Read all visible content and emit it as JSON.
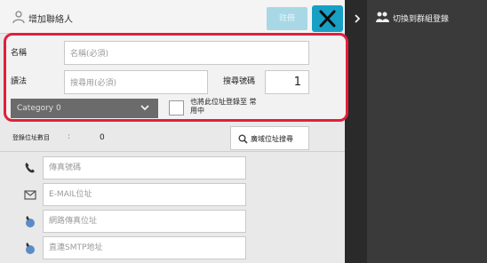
{
  "dialog": {
    "title": "增加聯絡人",
    "register_label": "註冊",
    "close_icon": "close-icon"
  },
  "form": {
    "name_label": "名稱",
    "name_placeholder": "名稱(必須)",
    "reading_label": "讀法",
    "reading_placeholder": "搜尋用(必須)",
    "search_number_label": "搜尋號碼",
    "search_number_value": "1",
    "category_value": "Category 0",
    "default_checkbox_text": "也將此位址登錄至 常用中",
    "default_checkbox_checked": false
  },
  "address": {
    "count_label": "登錄位址數目",
    "count_separator": ":",
    "count_value": "0",
    "global_search_label": "廣域位址搜尋",
    "rows": [
      {
        "icon": "fax-icon",
        "placeholder": "傳真號碼"
      },
      {
        "icon": "email-icon",
        "placeholder": "E-MAIL位址"
      },
      {
        "icon": "internet-fax-icon",
        "placeholder": "網路傳真位址"
      },
      {
        "icon": "smtp-icon",
        "placeholder": "直連SMTP地址"
      }
    ]
  },
  "side_panel": {
    "group_label": "切換到群組登錄",
    "group_icon": "group-icon"
  },
  "colors": {
    "accent": "#17a0c4",
    "highlight_border": "#e0203a"
  }
}
